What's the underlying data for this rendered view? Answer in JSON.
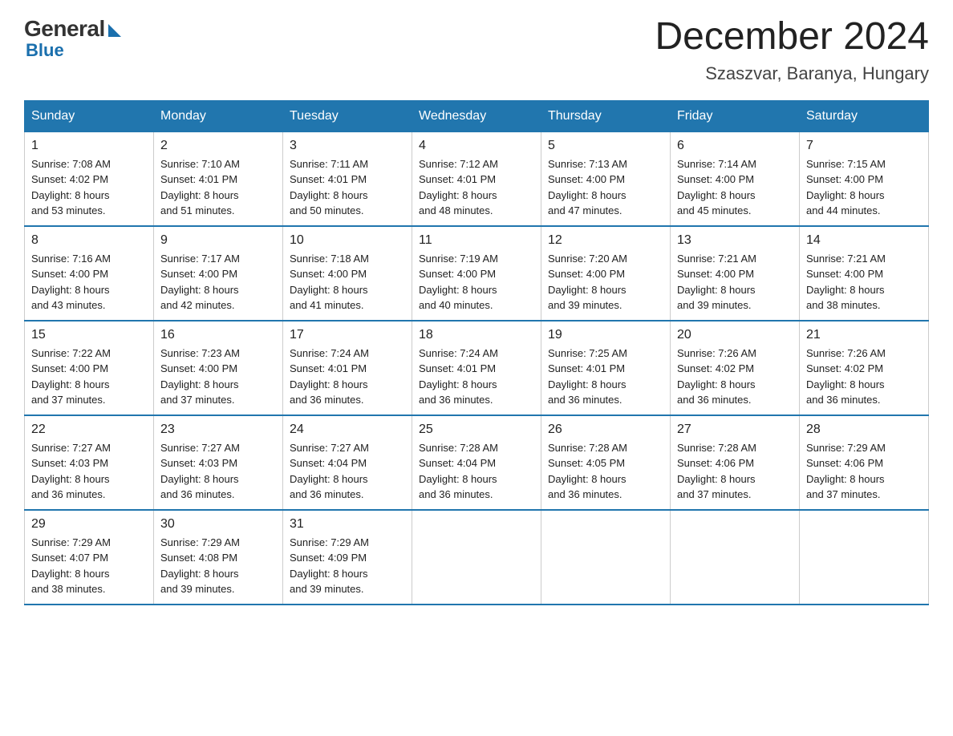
{
  "logo": {
    "general": "General",
    "blue": "Blue"
  },
  "title": {
    "month_year": "December 2024",
    "location": "Szaszvar, Baranya, Hungary"
  },
  "headers": [
    "Sunday",
    "Monday",
    "Tuesday",
    "Wednesday",
    "Thursday",
    "Friday",
    "Saturday"
  ],
  "weeks": [
    [
      {
        "day": "1",
        "sunrise": "7:08 AM",
        "sunset": "4:02 PM",
        "daylight": "8 hours and 53 minutes."
      },
      {
        "day": "2",
        "sunrise": "7:10 AM",
        "sunset": "4:01 PM",
        "daylight": "8 hours and 51 minutes."
      },
      {
        "day": "3",
        "sunrise": "7:11 AM",
        "sunset": "4:01 PM",
        "daylight": "8 hours and 50 minutes."
      },
      {
        "day": "4",
        "sunrise": "7:12 AM",
        "sunset": "4:01 PM",
        "daylight": "8 hours and 48 minutes."
      },
      {
        "day": "5",
        "sunrise": "7:13 AM",
        "sunset": "4:00 PM",
        "daylight": "8 hours and 47 minutes."
      },
      {
        "day": "6",
        "sunrise": "7:14 AM",
        "sunset": "4:00 PM",
        "daylight": "8 hours and 45 minutes."
      },
      {
        "day": "7",
        "sunrise": "7:15 AM",
        "sunset": "4:00 PM",
        "daylight": "8 hours and 44 minutes."
      }
    ],
    [
      {
        "day": "8",
        "sunrise": "7:16 AM",
        "sunset": "4:00 PM",
        "daylight": "8 hours and 43 minutes."
      },
      {
        "day": "9",
        "sunrise": "7:17 AM",
        "sunset": "4:00 PM",
        "daylight": "8 hours and 42 minutes."
      },
      {
        "day": "10",
        "sunrise": "7:18 AM",
        "sunset": "4:00 PM",
        "daylight": "8 hours and 41 minutes."
      },
      {
        "day": "11",
        "sunrise": "7:19 AM",
        "sunset": "4:00 PM",
        "daylight": "8 hours and 40 minutes."
      },
      {
        "day": "12",
        "sunrise": "7:20 AM",
        "sunset": "4:00 PM",
        "daylight": "8 hours and 39 minutes."
      },
      {
        "day": "13",
        "sunrise": "7:21 AM",
        "sunset": "4:00 PM",
        "daylight": "8 hours and 39 minutes."
      },
      {
        "day": "14",
        "sunrise": "7:21 AM",
        "sunset": "4:00 PM",
        "daylight": "8 hours and 38 minutes."
      }
    ],
    [
      {
        "day": "15",
        "sunrise": "7:22 AM",
        "sunset": "4:00 PM",
        "daylight": "8 hours and 37 minutes."
      },
      {
        "day": "16",
        "sunrise": "7:23 AM",
        "sunset": "4:00 PM",
        "daylight": "8 hours and 37 minutes."
      },
      {
        "day": "17",
        "sunrise": "7:24 AM",
        "sunset": "4:01 PM",
        "daylight": "8 hours and 36 minutes."
      },
      {
        "day": "18",
        "sunrise": "7:24 AM",
        "sunset": "4:01 PM",
        "daylight": "8 hours and 36 minutes."
      },
      {
        "day": "19",
        "sunrise": "7:25 AM",
        "sunset": "4:01 PM",
        "daylight": "8 hours and 36 minutes."
      },
      {
        "day": "20",
        "sunrise": "7:26 AM",
        "sunset": "4:02 PM",
        "daylight": "8 hours and 36 minutes."
      },
      {
        "day": "21",
        "sunrise": "7:26 AM",
        "sunset": "4:02 PM",
        "daylight": "8 hours and 36 minutes."
      }
    ],
    [
      {
        "day": "22",
        "sunrise": "7:27 AM",
        "sunset": "4:03 PM",
        "daylight": "8 hours and 36 minutes."
      },
      {
        "day": "23",
        "sunrise": "7:27 AM",
        "sunset": "4:03 PM",
        "daylight": "8 hours and 36 minutes."
      },
      {
        "day": "24",
        "sunrise": "7:27 AM",
        "sunset": "4:04 PM",
        "daylight": "8 hours and 36 minutes."
      },
      {
        "day": "25",
        "sunrise": "7:28 AM",
        "sunset": "4:04 PM",
        "daylight": "8 hours and 36 minutes."
      },
      {
        "day": "26",
        "sunrise": "7:28 AM",
        "sunset": "4:05 PM",
        "daylight": "8 hours and 36 minutes."
      },
      {
        "day": "27",
        "sunrise": "7:28 AM",
        "sunset": "4:06 PM",
        "daylight": "8 hours and 37 minutes."
      },
      {
        "day": "28",
        "sunrise": "7:29 AM",
        "sunset": "4:06 PM",
        "daylight": "8 hours and 37 minutes."
      }
    ],
    [
      {
        "day": "29",
        "sunrise": "7:29 AM",
        "sunset": "4:07 PM",
        "daylight": "8 hours and 38 minutes."
      },
      {
        "day": "30",
        "sunrise": "7:29 AM",
        "sunset": "4:08 PM",
        "daylight": "8 hours and 39 minutes."
      },
      {
        "day": "31",
        "sunrise": "7:29 AM",
        "sunset": "4:09 PM",
        "daylight": "8 hours and 39 minutes."
      },
      null,
      null,
      null,
      null
    ]
  ]
}
